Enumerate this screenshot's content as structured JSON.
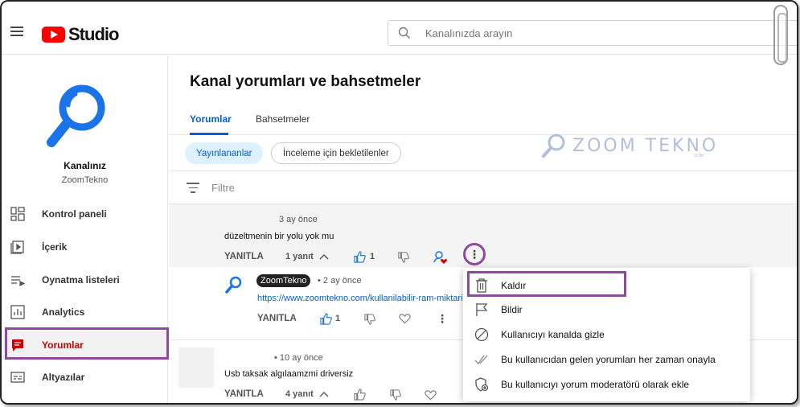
{
  "app": {
    "brand": "Studio"
  },
  "search": {
    "placeholder": "Kanalınızda arayın"
  },
  "channel": {
    "title": "Kanalınız",
    "handle": "ZoomTekno"
  },
  "sidebar": {
    "items": [
      {
        "label": "Kontrol paneli",
        "icon": "dashboard-icon"
      },
      {
        "label": "İçerik",
        "icon": "content-icon"
      },
      {
        "label": "Oynatma listeleri",
        "icon": "playlist-icon"
      },
      {
        "label": "Analytics",
        "icon": "analytics-icon"
      },
      {
        "label": "Yorumlar",
        "icon": "comments-icon"
      },
      {
        "label": "Altyazılar",
        "icon": "subtitles-icon"
      }
    ]
  },
  "main": {
    "title": "Kanal yorumları ve bahsetmeler",
    "tabs": [
      "Yorumlar",
      "Bahsetmeler"
    ],
    "chips": [
      "Yayınlananlar",
      "İnceleme için bekletilenler"
    ],
    "filter_placeholder": "Filtre",
    "watermark": {
      "text": "ZOOM TEKNO",
      "sub": ".COM"
    }
  },
  "comments": [
    {
      "time": "3 ay önce",
      "text": "düzeltmenin bir yolu yok mu",
      "reply_label": "YANITLA",
      "replies_label": "1 yanıt",
      "likes": "1"
    },
    {
      "author": "ZoomTekno",
      "time": "• 2 ay önce",
      "text": "https://www.zoomtekno.com/kullanilabilir-ram-miktari-nasil-artirilir",
      "reply_label": "YANITLA",
      "likes": "1"
    },
    {
      "time": "• 10 ay önce",
      "text": "Usb taksak algılaamzmi driversiz",
      "reply_label": "YANITLA",
      "replies_label": "4 yanıt"
    }
  ],
  "menu": {
    "items": [
      {
        "label": "Kaldır",
        "icon": "trash-icon"
      },
      {
        "label": "Bildir",
        "icon": "flag-icon"
      },
      {
        "label": "Kullanıcıyı kanalda gizle",
        "icon": "block-icon"
      },
      {
        "label": "Bu kullanıcıdan gelen yorumları her zaman onayla",
        "icon": "checkmark-icon"
      },
      {
        "label": "Bu kullanıcıyı yorum moderatörü olarak ekle",
        "icon": "shield-add-icon"
      }
    ]
  },
  "colors": {
    "accent": "#065fd4",
    "brand_red": "#ff0000",
    "highlight": "#8e4b9e"
  }
}
